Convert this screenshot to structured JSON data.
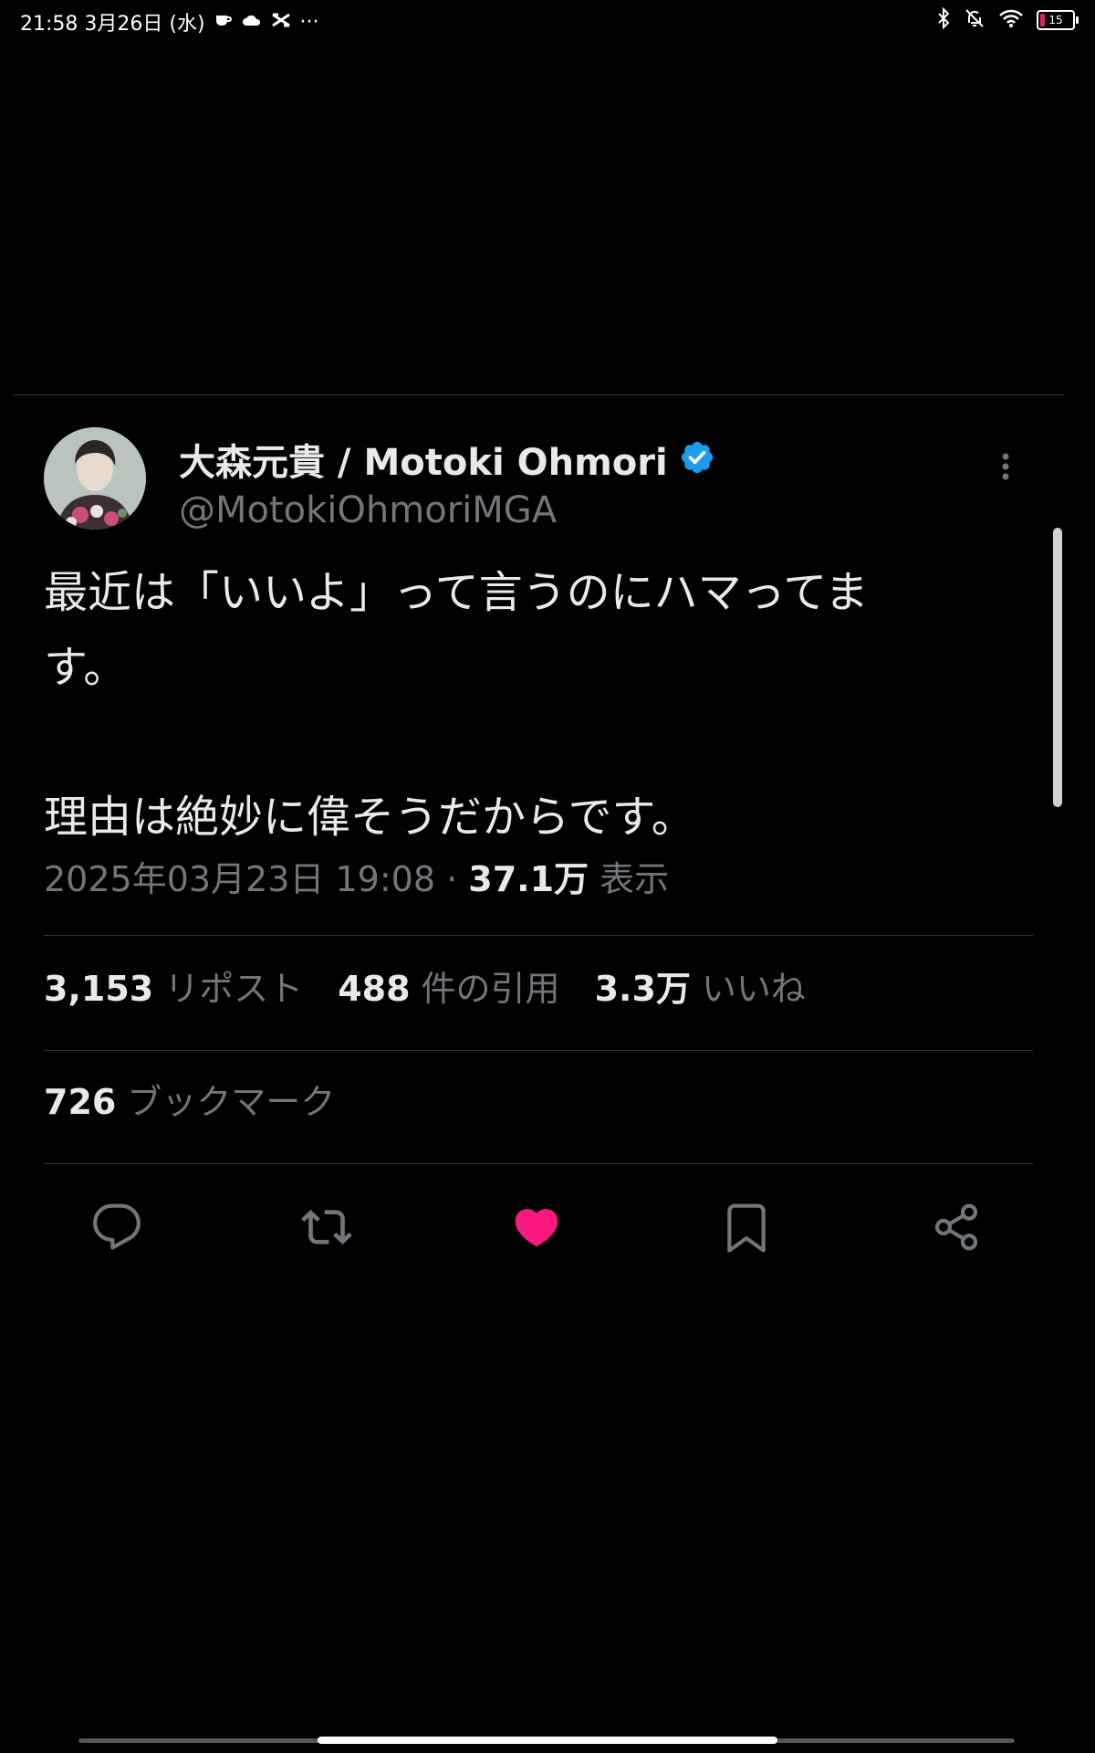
{
  "status_bar": {
    "time_date": "21:58 3月26日 (水)",
    "more": "···",
    "battery_level": "15"
  },
  "tweet": {
    "display_name": "大森元貴 / Motoki Ohmori",
    "handle": "@MotokiOhmoriMGA",
    "verified": true,
    "text": "最近は「いいよ」って言うのにハマってま\nす。\n\n理由は絶妙に偉そうだからです。",
    "timestamp": "2025年03月23日 19:08",
    "separator": "·",
    "views_count": "37.1万",
    "views_label": "表示",
    "reposts_count": "3,153",
    "reposts_label": "リポスト",
    "quotes_count": "488",
    "quotes_label": "件の引用",
    "likes_count": "3.3万",
    "likes_label": "いいね",
    "bookmarks_count": "726",
    "bookmarks_label": "ブックマーク",
    "liked": true
  },
  "colors": {
    "background": "#000000",
    "text_primary": "#e7e9ea",
    "text_secondary": "#71767b",
    "divider": "#2f3336",
    "verified_blue": "#1d9bf0",
    "like_pink": "#f91880"
  },
  "icons": {
    "reply": "reply-icon",
    "repost": "repost-icon",
    "like": "heart-icon",
    "bookmark": "bookmark-icon",
    "share": "share-icon",
    "more": "more-vertical-icon",
    "verified": "verified-badge-icon"
  }
}
